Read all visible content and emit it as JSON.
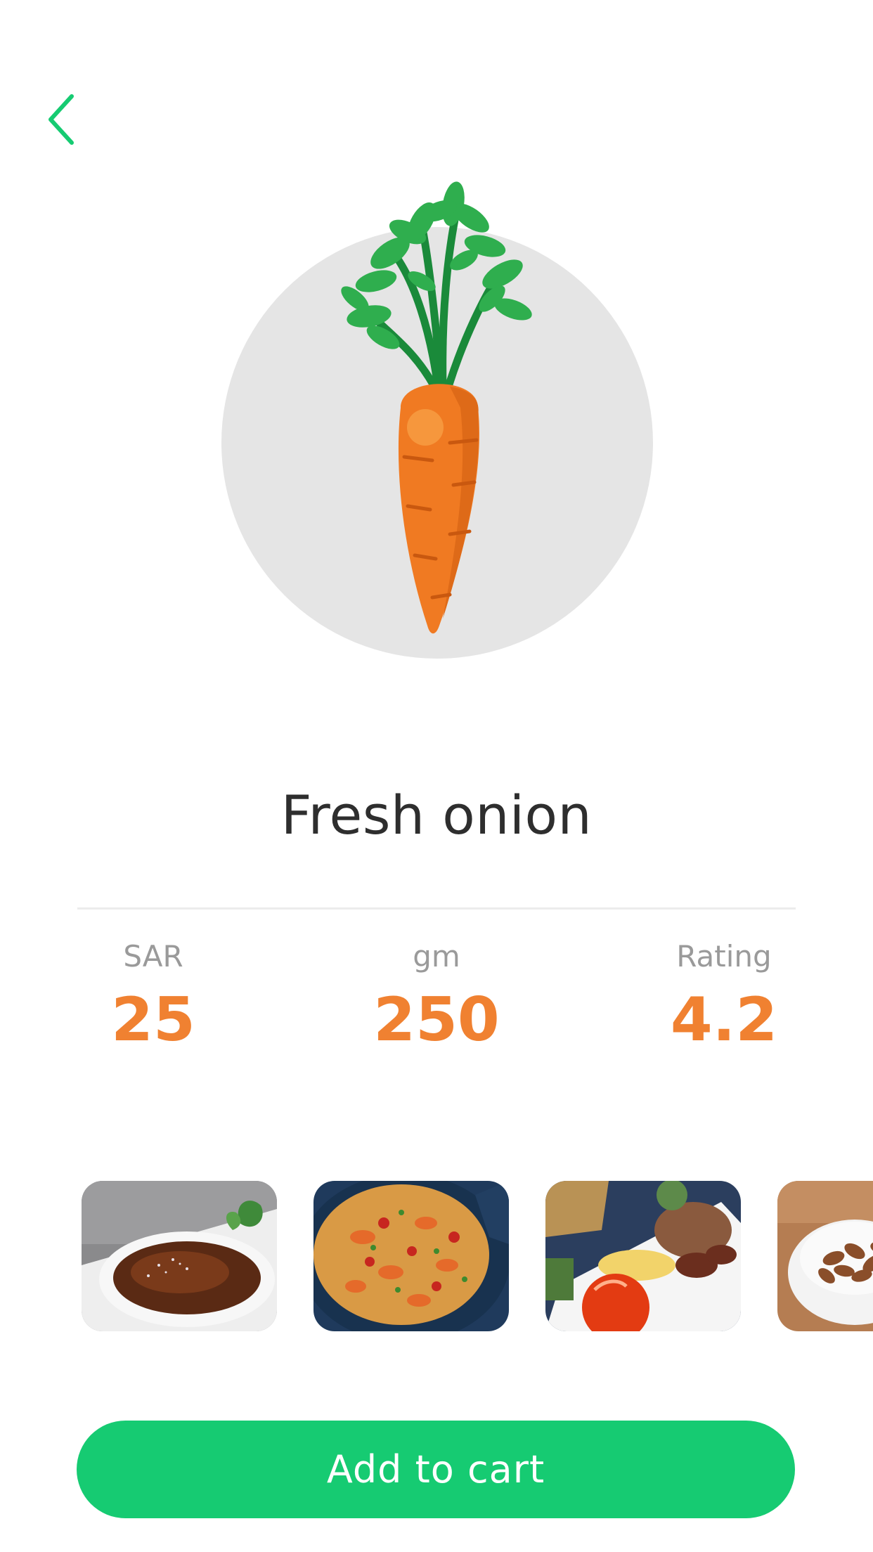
{
  "header": {
    "back_icon": "chevron-left-icon",
    "accent_color": "#16cb72"
  },
  "product": {
    "image_icon": "carrot-illustration",
    "title": "Fresh onion"
  },
  "stats": [
    {
      "label": "SAR",
      "value": "25"
    },
    {
      "label": "gm",
      "value": "250"
    },
    {
      "label": "Rating",
      "value": "4.2"
    }
  ],
  "gallery": {
    "items": [
      "creme-brulee-photo",
      "paella-photo",
      "rice-platter-photo",
      "almonds-photo"
    ]
  },
  "cart_button": {
    "label": "Add to cart",
    "color": "#16cb72"
  },
  "colors": {
    "value_color": "#f08131",
    "label_color": "#9a9a9a",
    "title_color": "#2e2e2e"
  }
}
